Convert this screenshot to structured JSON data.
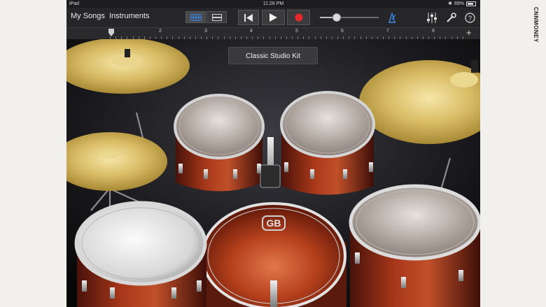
{
  "status_bar": {
    "device": "iPad",
    "time": "11:26 PM",
    "battery": "89%"
  },
  "toolbar": {
    "my_songs_label": "My Songs",
    "instruments_label": "Instruments",
    "view_toggle_icons": [
      "tracks-view-icon",
      "grid-view-icon"
    ],
    "transport_icons": [
      "rewind-icon",
      "play-icon",
      "record-icon"
    ],
    "master_volume_level": 0.25,
    "right_icons": [
      "metronome-icon",
      "mixer-icon",
      "settings-icon",
      "help-icon"
    ]
  },
  "ruler": {
    "bar_numbers": [
      "2",
      "3",
      "4",
      "5",
      "6",
      "7",
      "8"
    ]
  },
  "kit": {
    "name": "Classic Studio Kit",
    "bass_drum_logo": "GB"
  },
  "colors": {
    "accent_blue": "#3b8df0",
    "record_red": "#e62a2a",
    "shell_red": "#8a2a14",
    "cymbal_gold": "#cfae52"
  },
  "watermark": "CNNMONEY"
}
